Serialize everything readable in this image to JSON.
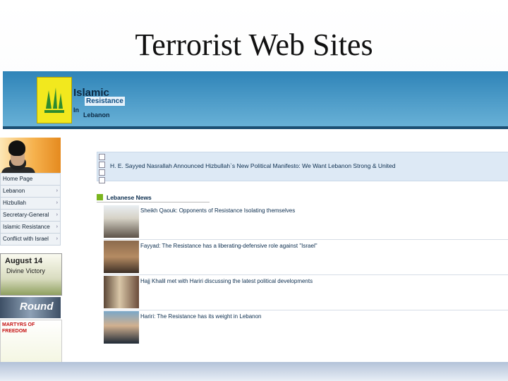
{
  "slide": {
    "title": "Terrorist Web Sites"
  },
  "banner": {
    "logo": {
      "line1": "Islamic",
      "line2": "Resistance",
      "line3": "In",
      "line4": "Lebanon"
    }
  },
  "sidebar": {
    "menu": [
      {
        "label": "Home Page"
      },
      {
        "label": "Lebanon"
      },
      {
        "label": "Hizbullah"
      },
      {
        "label": "Secretary-General"
      },
      {
        "label": "Islamic Resistance"
      },
      {
        "label": "Conflict with Israel"
      }
    ],
    "promos": {
      "august": {
        "line1": "August 14",
        "line2": "Divine Victory"
      },
      "round": {
        "text": "Round"
      },
      "martyrs": {
        "line1": "MARTYRS OF",
        "line2": "FREEDOM"
      }
    }
  },
  "main": {
    "headline": "H. E. Sayyed Nasrallah Announced Hizbullah`s New Political Manifesto: We Want Lebanon Strong & United",
    "section": "Lebanese News",
    "news": [
      {
        "title": "Sheikh Qaouk: Opponents of Resistance Isolating themselves"
      },
      {
        "title": "Fayyad: The Resistance has a liberating-defensive role against \"Israel\""
      },
      {
        "title": "Hajj Khalil met with Hariri discussing the latest political developments"
      },
      {
        "title": "Hariri: The Resistance has its weight in Lebanon"
      }
    ]
  },
  "colors": {
    "banner": "#2f84b8",
    "accent": "#7ab51e",
    "logo_bg": "#f2e81e"
  }
}
